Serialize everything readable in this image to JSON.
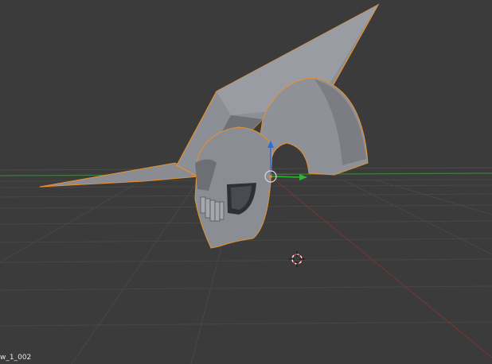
{
  "viewport": {
    "object_name": "w_1_002",
    "background_color": "#3b3b3b",
    "grid_color": "#4a4a4a",
    "x_axis_color": "#8a3a3a",
    "y_axis_color": "#3f8a3f",
    "selection_outline_color": "#e8902a",
    "mesh_color": "#8d8f96"
  },
  "gizmo": {
    "z_axis_color": "#2e6ae0",
    "y_axis_color": "#2fb82f",
    "center_color": "#d8d8d8"
  },
  "cursor": {
    "icon": "3d-cursor-icon",
    "color_a": "#cc3a3a",
    "color_b": "#ffffff"
  }
}
